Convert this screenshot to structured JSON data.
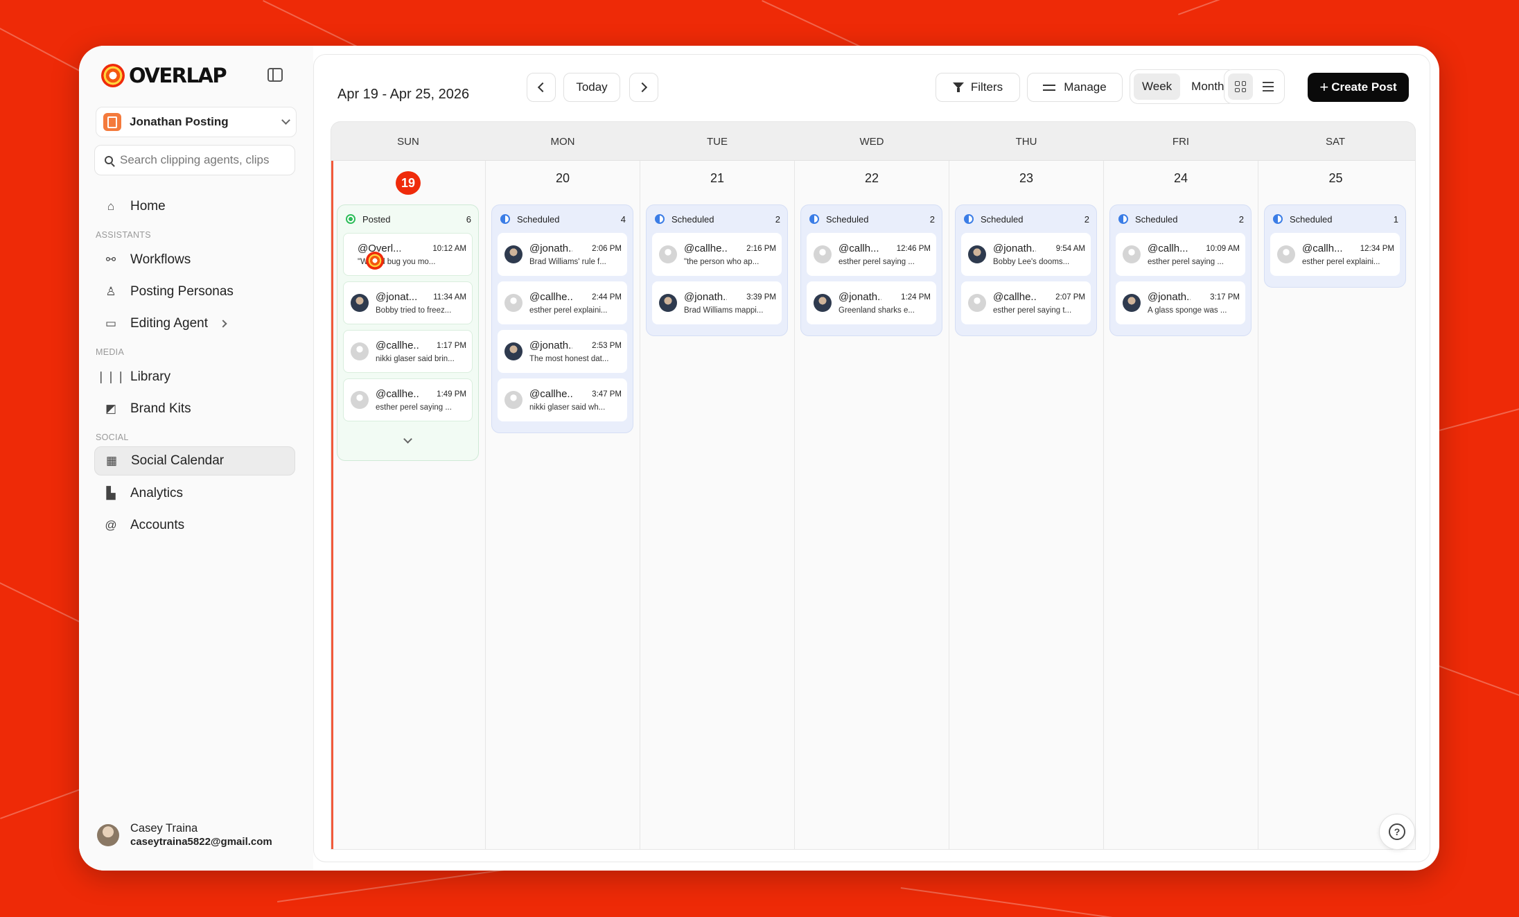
{
  "brand": {
    "name": "OVERLAP"
  },
  "workspace": {
    "name": "Jonathan Posting"
  },
  "search": {
    "placeholder": "Search clipping agents, clips"
  },
  "nav": {
    "home": "Home",
    "assistants_label": "ASSISTANTS",
    "workflows": "Workflows",
    "posting_personas": "Posting Personas",
    "editing_agent": "Editing Agent",
    "media_label": "MEDIA",
    "library": "Library",
    "brand_kits": "Brand Kits",
    "social_label": "SOCIAL",
    "social_calendar": "Social Calendar",
    "analytics": "Analytics",
    "accounts": "Accounts"
  },
  "user": {
    "name": "Casey Traina",
    "email": "caseytraina5822@gmail.com"
  },
  "toolbar": {
    "date_range": "Apr 19 - Apr 25, 2026",
    "today": "Today",
    "filters": "Filters",
    "manage": "Manage",
    "week": "Week",
    "month": "Month",
    "create_post": "Create Post"
  },
  "colors": {
    "accent": "#ef2b0b",
    "posted": "#2ebd5a",
    "scheduled": "#3b7de6"
  },
  "days": [
    {
      "name": "SUN",
      "date": "19",
      "status": "Posted",
      "count": "6",
      "posts": [
        {
          "handle": "@Overl...",
          "time": "10:12 AM",
          "caption": "\"What'd bug you mo...",
          "avatar": "logo"
        },
        {
          "handle": "@jonat...",
          "time": "11:34 AM",
          "caption": "Bobby tried to freez...",
          "avatar": "man"
        },
        {
          "handle": "@callhe...",
          "time": "1:17 PM",
          "caption": "nikki glaser said brin...",
          "avatar": "ghost"
        },
        {
          "handle": "@callhe...",
          "time": "1:49 PM",
          "caption": "esther perel saying ...",
          "avatar": "ghost"
        }
      ]
    },
    {
      "name": "MON",
      "date": "20",
      "status": "Scheduled",
      "count": "4",
      "posts": [
        {
          "handle": "@jonath...",
          "time": "2:06 PM",
          "caption": "Brad Williams' rule f...",
          "avatar": "man"
        },
        {
          "handle": "@callhe...",
          "time": "2:44 PM",
          "caption": "esther perel explaini...",
          "avatar": "ghost"
        },
        {
          "handle": "@jonath...",
          "time": "2:53 PM",
          "caption": "The most honest dat...",
          "avatar": "man"
        },
        {
          "handle": "@callhe...",
          "time": "3:47 PM",
          "caption": "nikki glaser said wh...",
          "avatar": "ghost"
        }
      ]
    },
    {
      "name": "TUE",
      "date": "21",
      "status": "Scheduled",
      "count": "2",
      "posts": [
        {
          "handle": "@callhe...",
          "time": "2:16 PM",
          "caption": "\"the person who ap...",
          "avatar": "ghost"
        },
        {
          "handle": "@jonath...",
          "time": "3:39 PM",
          "caption": "Brad Williams mappi...",
          "avatar": "man"
        }
      ]
    },
    {
      "name": "WED",
      "date": "22",
      "status": "Scheduled",
      "count": "2",
      "posts": [
        {
          "handle": "@callh...",
          "time": "12:46 PM",
          "caption": "esther perel saying ...",
          "avatar": "ghost"
        },
        {
          "handle": "@jonath...",
          "time": "1:24 PM",
          "caption": "Greenland sharks e...",
          "avatar": "man"
        }
      ]
    },
    {
      "name": "THU",
      "date": "23",
      "status": "Scheduled",
      "count": "2",
      "posts": [
        {
          "handle": "@jonath...",
          "time": "9:54 AM",
          "caption": "Bobby Lee's dooms...",
          "avatar": "man"
        },
        {
          "handle": "@callhe...",
          "time": "2:07 PM",
          "caption": "esther perel saying t...",
          "avatar": "ghost"
        }
      ]
    },
    {
      "name": "FRI",
      "date": "24",
      "status": "Scheduled",
      "count": "2",
      "posts": [
        {
          "handle": "@callh...",
          "time": "10:09 AM",
          "caption": "esther perel saying ...",
          "avatar": "ghost"
        },
        {
          "handle": "@jonath...",
          "time": "3:17 PM",
          "caption": "A glass sponge was ...",
          "avatar": "man"
        }
      ]
    },
    {
      "name": "SAT",
      "date": "25",
      "status": "Scheduled",
      "count": "1",
      "posts": [
        {
          "handle": "@callh...",
          "time": "12:34 PM",
          "caption": "esther perel explaini...",
          "avatar": "ghost"
        }
      ]
    }
  ]
}
